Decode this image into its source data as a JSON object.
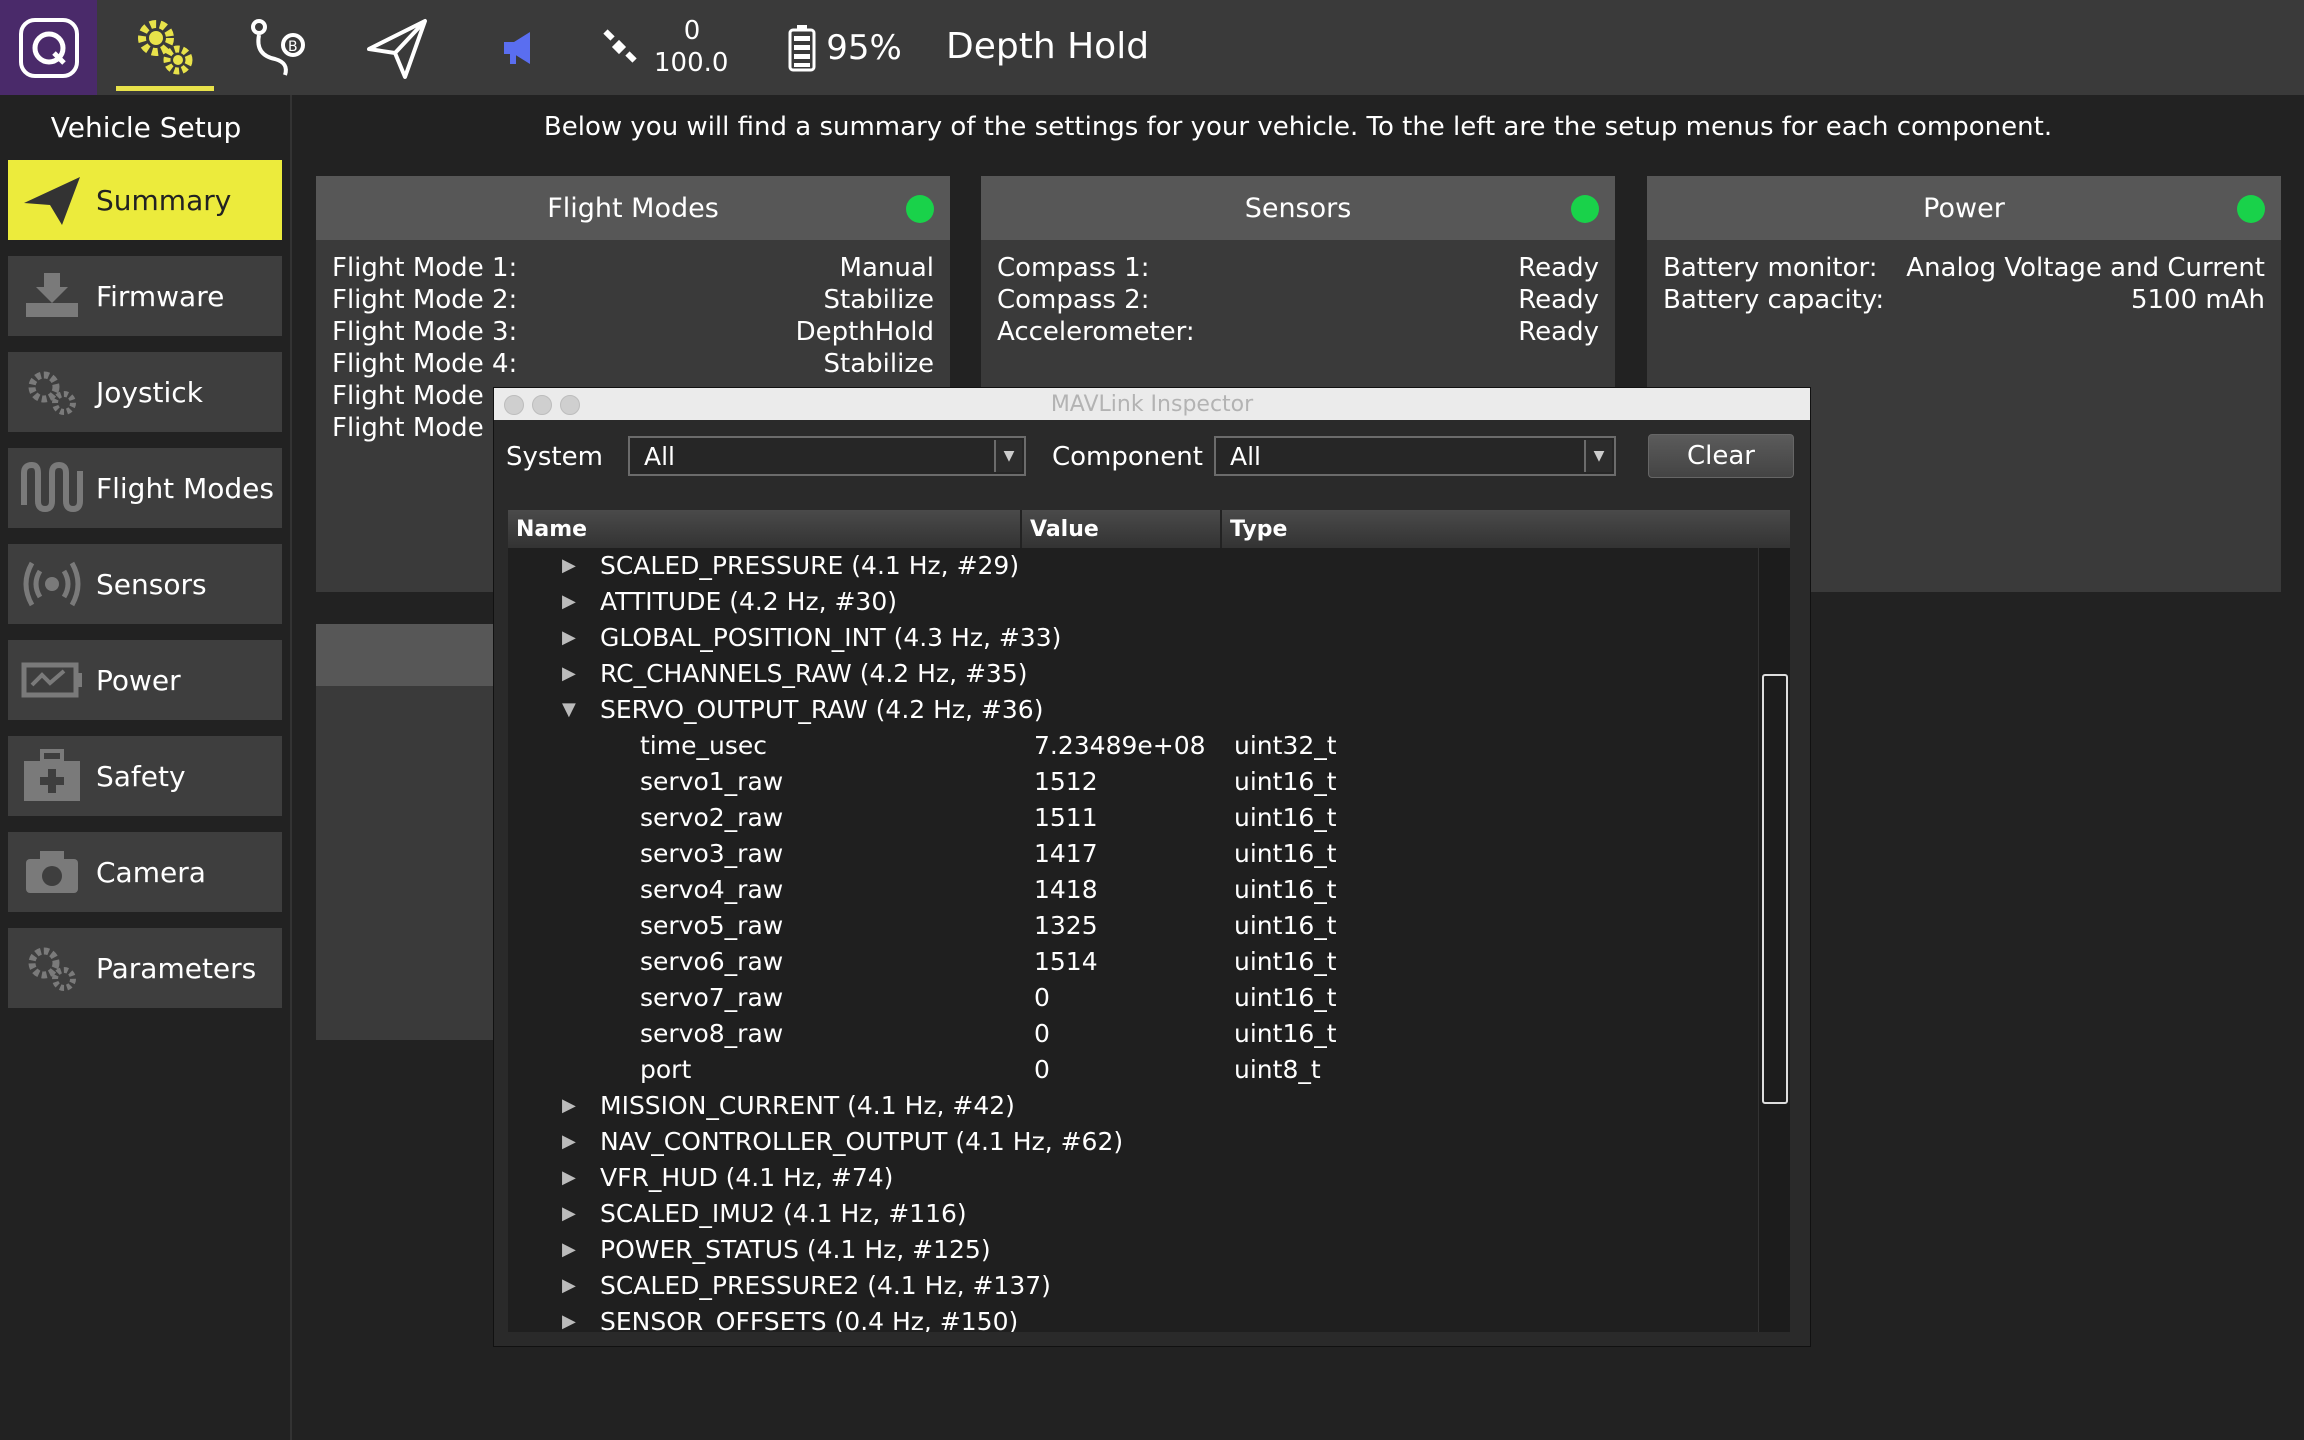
{
  "toolbar": {
    "gps_count": "0",
    "gps_hdop": "100.0",
    "battery": "95%",
    "flight_mode": "Depth Hold"
  },
  "sidebar": {
    "title": "Vehicle Setup",
    "items": [
      {
        "label": "Summary"
      },
      {
        "label": "Firmware"
      },
      {
        "label": "Joystick"
      },
      {
        "label": "Flight Modes"
      },
      {
        "label": "Sensors"
      },
      {
        "label": "Power"
      },
      {
        "label": "Safety"
      },
      {
        "label": "Camera"
      },
      {
        "label": "Parameters"
      }
    ]
  },
  "summary": {
    "description": "Below you will find a summary of the settings for your vehicle. To the left are the setup menus for each component."
  },
  "cards": {
    "flight_modes": {
      "title": "Flight Modes",
      "rows": [
        {
          "k": "Flight Mode 1:",
          "v": "Manual"
        },
        {
          "k": "Flight Mode 2:",
          "v": "Stabilize"
        },
        {
          "k": "Flight Mode 3:",
          "v": "DepthHold"
        },
        {
          "k": "Flight Mode 4:",
          "v": "Stabilize"
        },
        {
          "k": "Flight Mode",
          "v": ""
        },
        {
          "k": "Flight Mode (",
          "v": ""
        }
      ]
    },
    "sensors": {
      "title": "Sensors",
      "rows": [
        {
          "k": "Compass 1:",
          "v": "Ready"
        },
        {
          "k": "Compass 2:",
          "v": "Ready"
        },
        {
          "k": "Accelerometer:",
          "v": "Ready"
        }
      ]
    },
    "power": {
      "title": "Power",
      "rows": [
        {
          "k": "Battery monitor:",
          "v": "Analog Voltage and Current"
        },
        {
          "k": "Battery capacity:",
          "v": "5100 mAh"
        }
      ]
    },
    "status_color": "#19d24a"
  },
  "inspector": {
    "title": "MAVLink Inspector",
    "system_label": "System",
    "system_value": "All",
    "component_label": "Component",
    "component_value": "All",
    "clear_label": "Clear",
    "columns": [
      "Name",
      "Value",
      "Type"
    ],
    "rows": [
      {
        "name": "SCALED_PRESSURE (4.1 Hz, #29)",
        "expanded": false,
        "child": false
      },
      {
        "name": "ATTITUDE (4.2 Hz, #30)",
        "expanded": false,
        "child": false
      },
      {
        "name": "GLOBAL_POSITION_INT (4.3 Hz, #33)",
        "expanded": false,
        "child": false
      },
      {
        "name": "RC_CHANNELS_RAW (4.2 Hz, #35)",
        "expanded": false,
        "child": false
      },
      {
        "name": "SERVO_OUTPUT_RAW (4.2 Hz, #36)",
        "expanded": true,
        "child": false
      },
      {
        "name": "time_usec",
        "value": "7.23489e+08",
        "type": "uint32_t",
        "child": true
      },
      {
        "name": "servo1_raw",
        "value": "1512",
        "type": "uint16_t",
        "child": true
      },
      {
        "name": "servo2_raw",
        "value": "1511",
        "type": "uint16_t",
        "child": true
      },
      {
        "name": "servo3_raw",
        "value": "1417",
        "type": "uint16_t",
        "child": true
      },
      {
        "name": "servo4_raw",
        "value": "1418",
        "type": "uint16_t",
        "child": true
      },
      {
        "name": "servo5_raw",
        "value": "1325",
        "type": "uint16_t",
        "child": true
      },
      {
        "name": "servo6_raw",
        "value": "1514",
        "type": "uint16_t",
        "child": true
      },
      {
        "name": "servo7_raw",
        "value": "0",
        "type": "uint16_t",
        "child": true
      },
      {
        "name": "servo8_raw",
        "value": "0",
        "type": "uint16_t",
        "child": true
      },
      {
        "name": "port",
        "value": "0",
        "type": "uint8_t",
        "child": true
      },
      {
        "name": "MISSION_CURRENT (4.1 Hz, #42)",
        "expanded": false,
        "child": false
      },
      {
        "name": "NAV_CONTROLLER_OUTPUT (4.1 Hz, #62)",
        "expanded": false,
        "child": false
      },
      {
        "name": "VFR_HUD (4.1 Hz, #74)",
        "expanded": false,
        "child": false
      },
      {
        "name": "SCALED_IMU2 (4.1 Hz, #116)",
        "expanded": false,
        "child": false
      },
      {
        "name": "POWER_STATUS (4.1 Hz, #125)",
        "expanded": false,
        "child": false
      },
      {
        "name": "SCALED_PRESSURE2 (4.1 Hz, #137)",
        "expanded": false,
        "child": false
      },
      {
        "name": "SENSOR_OFFSETS (0.4 Hz, #150)",
        "expanded": false,
        "child": false
      }
    ]
  }
}
